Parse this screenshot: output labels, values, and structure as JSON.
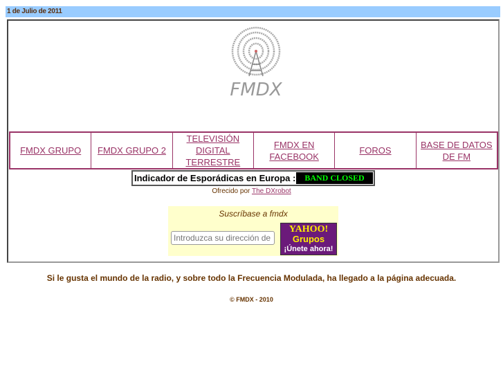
{
  "date": "1 de Julio de 2011",
  "logo_text": "FMDX",
  "nav": [
    "FMDX GRUPO",
    "FMDX GRUPO 2",
    "TELEVISIÓN DIGITAL TERRESTRE",
    "FMDX EN FACEBOOK",
    "FOROS",
    "BASE DE DATOS DE FM"
  ],
  "indicator": {
    "label": "Indicador de Esporádicas en Europa :",
    "status": "BAND CLOSED",
    "status_color": "#00ff00"
  },
  "offered": {
    "prefix": "Ofrecido por",
    "link": "The DXrobot"
  },
  "subscribe": {
    "title": "Suscríbase a fmdx",
    "placeholder": "Introduzca su dirección de",
    "yahoo_line1": "YAHOO!",
    "yahoo_line2": "Grupos",
    "yahoo_line3": "¡Únete ahora!"
  },
  "tagline": "Si le gusta el mundo de la radio, y sobre todo la Frecuencia Modulada, ha llegado a la página adecuada.",
  "copyright": "© FMDX - 2010"
}
